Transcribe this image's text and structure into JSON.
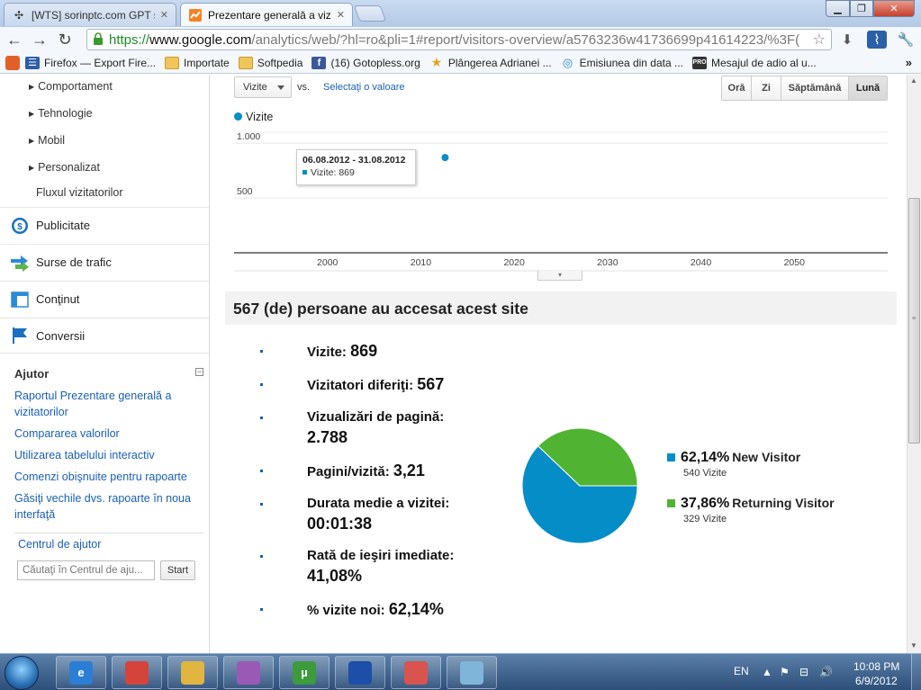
{
  "browser": {
    "tabs": [
      {
        "title": "[WTS] sorinptc.com GPT s"
      },
      {
        "title": "Prezentare generală a vizita"
      }
    ],
    "url": {
      "scheme": "https://",
      "host": "www.google.com",
      "path": "/analytics/web/?hl=ro&pli=1#report/visitors-overview/a5763236w41736699p41614223/%3F("
    },
    "bookmarks": [
      {
        "label": "Firefox — Export Fire...",
        "icon": "bookmarks-list-icon"
      },
      {
        "label": "Importate",
        "icon": "folder-icon"
      },
      {
        "label": "Softpedia",
        "icon": "folder-icon"
      },
      {
        "label": "(16) Gotopless.org",
        "icon": "facebook-icon"
      },
      {
        "label": "Plângerea Adrianei ...",
        "icon": "star-icon"
      },
      {
        "label": "Emisiunea din data ...",
        "icon": "globe-icon"
      },
      {
        "label": "Mesajul de adio al u...",
        "icon": "pro-tv-icon"
      }
    ],
    "more": "»"
  },
  "sidebar": {
    "sub_items": [
      {
        "label": "Comportament",
        "expandable": true
      },
      {
        "label": "Tehnologie",
        "expandable": true
      },
      {
        "label": "Mobil",
        "expandable": true
      },
      {
        "label": "Personalizat",
        "expandable": true
      },
      {
        "label": "Fluxul vizitatorilor",
        "expandable": false
      }
    ],
    "main_items": [
      {
        "label": "Publicitate",
        "icon": "dollar-icon"
      },
      {
        "label": "Surse de trafic",
        "icon": "traffic-arrows-icon"
      },
      {
        "label": "Conţinut",
        "icon": "content-icon"
      },
      {
        "label": "Conversii",
        "icon": "flag-icon"
      }
    ],
    "help": {
      "title": "Ajutor",
      "links": [
        "Raportul Prezentare generală a vizitatorilor",
        "Compararea valorilor",
        "Utilizarea tabelului interactiv",
        "Comenzi obişnuite pentru rapoarte",
        "Găsiţi vechile dvs. rapoarte în noua interfaţă"
      ],
      "center_label": "Centrul de ajutor",
      "search_placeholder": "Căutaţi în Centrul de aju...",
      "start_label": "Start"
    }
  },
  "controls": {
    "metric": "Vizite",
    "vs": "vs.",
    "compare": "Selectaţi o valoare",
    "granularity": [
      {
        "label": "Oră",
        "selected": false
      },
      {
        "label": "Zi",
        "selected": false
      },
      {
        "label": "Săptămână",
        "selected": false
      },
      {
        "label": "Lună",
        "selected": true
      }
    ]
  },
  "chart_data": {
    "type": "scatter",
    "title": "",
    "legend": [
      "Vizite"
    ],
    "legend_position": "top-left",
    "series": [
      {
        "name": "Vizite",
        "color": "#058dc7",
        "points": [
          {
            "x": 2012.6,
            "y": 869
          }
        ]
      }
    ],
    "x_ticks": [
      2000,
      2010,
      2020,
      2030,
      2040,
      2050
    ],
    "x_tick_labels": [
      "2000",
      "2010",
      "2020",
      "2030",
      "2040",
      "2050"
    ],
    "y_ticks": [
      500,
      1000
    ],
    "y_tick_labels": [
      "500",
      "1.000"
    ],
    "xlim": [
      1990,
      2060
    ],
    "ylim": [
      0,
      1100
    ],
    "grid": true,
    "tooltip": {
      "range": "06.08.2012 - 31.08.2012",
      "label": "Vizite",
      "value": "869"
    }
  },
  "summary": {
    "headline": "567 (de) persoane au accesat acest site",
    "stats": [
      {
        "label": "Vizite:",
        "value": "869"
      },
      {
        "label": "Vizitatori diferiţi:",
        "value": "567"
      },
      {
        "label": "Vizualizări de pagină:",
        "value": "2.788"
      },
      {
        "label": "Pagini/vizită:",
        "value": "3,21"
      },
      {
        "label": "Durata medie a vizitei:",
        "value": "00:01:38"
      },
      {
        "label": "Rată de ieşiri imediate:",
        "value": "41,08%"
      },
      {
        "label": "% vizite noi:",
        "value": "62,14%"
      }
    ]
  },
  "pie": {
    "slices": [
      {
        "name": "New Visitor",
        "percent": 62.14,
        "percent_label": "62,14%",
        "count_label": "540 Vizite",
        "color": "#058dc7"
      },
      {
        "name": "Returning Visitor",
        "percent": 37.86,
        "percent_label": "37,86%",
        "count_label": "329 Vizite",
        "color": "#50b432"
      }
    ]
  },
  "taskbar": {
    "apps": [
      {
        "name": "internet-explorer-icon",
        "color": "#2a7fd4",
        "glyph": "e"
      },
      {
        "name": "chrome-icon",
        "color": "#d6433a",
        "glyph": ""
      },
      {
        "name": "explorer-icon",
        "color": "#e0b640",
        "glyph": ""
      },
      {
        "name": "messenger-icon",
        "color": "#9b59b6",
        "glyph": ""
      },
      {
        "name": "utorrent-icon",
        "color": "#3d9a3d",
        "glyph": "µ"
      },
      {
        "name": "app-blue-icon",
        "color": "#1d4fa8",
        "glyph": ""
      },
      {
        "name": "app-puzzle-icon",
        "color": "#d9534f",
        "glyph": ""
      },
      {
        "name": "app-paper-icon",
        "color": "#7fb5d8",
        "glyph": ""
      }
    ],
    "language": "EN",
    "time": "10:08 PM",
    "date": "6/9/2012"
  }
}
